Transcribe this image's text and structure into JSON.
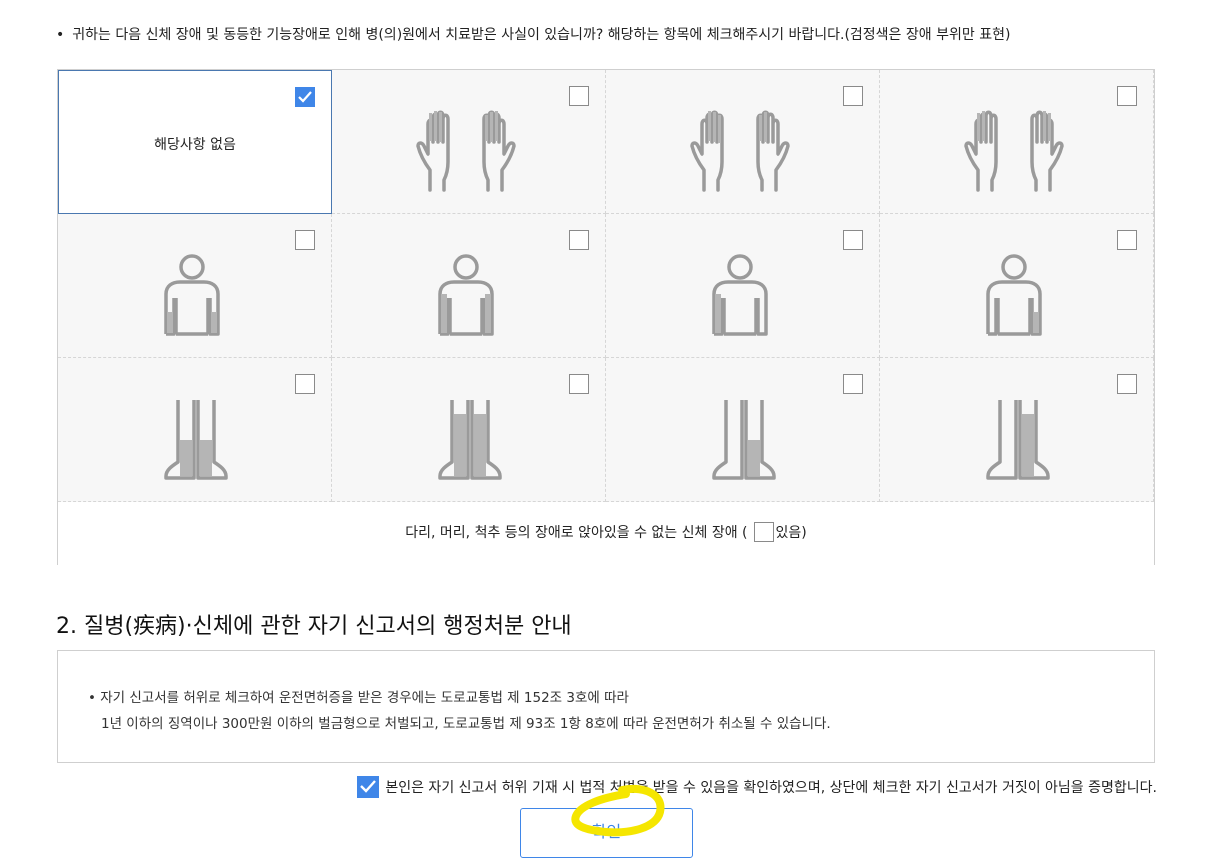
{
  "question": {
    "bullet": "•",
    "text": "귀하는 다음 신체 장애 및 동등한 기능장애로 인해 병(의)원에서 치료받은 사실이 있습니까? 해당하는 항목에 체크해주시기 바랍니다.(검정색은 장애 부위만 표현)"
  },
  "grid": {
    "none_label": "해당사항 없음",
    "none_checked": true,
    "hands_icon": "hands-icon",
    "body_icon": "upper-body-icon",
    "legs_icon": "legs-icon",
    "footer_text_before": "다리, 머리, 척추 등의 장애로 앉아있을 수 없는 신체 장애 (",
    "footer_text_after": "있음)"
  },
  "section": {
    "title": "2. 질병(疾病)·신체에 관한 자기 신고서의 행정처분 안내"
  },
  "notice": {
    "line1": "• 자기 신고서를 허위로 체크하여 운전면허증을 받은 경우에는 도로교통법 제 152조 3호에 따라",
    "line2": "1년 이하의 징역이나 300만원 이하의 벌금형으로 처벌되고, 도로교통법 제 93조 1항 8호에 따라 운전면허가 취소될 수 있습니다."
  },
  "agreement": {
    "checked": true,
    "text": "본인은 자기 신고서 허위 기재 시 법적 처벌을 받을 수 있음을 확인하였으며, 상단에 체크한 자기 신고서가 거짓이 아님을 증명합니다."
  },
  "button": {
    "label": "확인"
  },
  "colors": {
    "accent": "#3f86e8",
    "selected_border": "#4a78b0",
    "figure_gray": "#9a9a9a",
    "highlight": "#f5e600"
  }
}
